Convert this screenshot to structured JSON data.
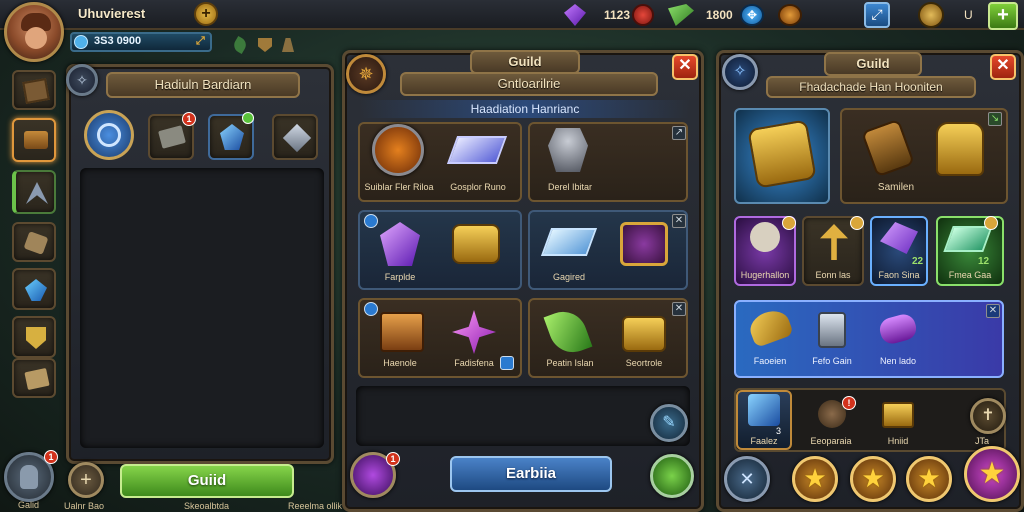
{
  "topbar": {
    "player_name": "Uhuvierest",
    "gold_value": "3S3 0900",
    "purple_value": "1123",
    "green_value": "1800",
    "scroll_value": "U"
  },
  "left_panel": {
    "banner": "Hadiuln Bardiarn",
    "guild_button": "Guiid",
    "bottom_labels": [
      "Ualnr Bao",
      "Skeoalbtda",
      "Reeelma ollik"
    ],
    "avatar_label": "Galid"
  },
  "center_panel": {
    "title": "Guild",
    "subtitle": "Gntloarilrie",
    "banner": "Haadiation Hanrianc",
    "items": [
      "Suiblar Fler Riloa",
      "Gosplor Runo",
      "Derel Ibitar",
      "Farplde",
      "",
      "Gagired",
      "",
      "Haenole",
      "Fadisfena",
      "Peatin Islan",
      "Seortrole"
    ],
    "button": "Earbiia"
  },
  "right_panel": {
    "title": "Guild",
    "banner": "Fhadachade Han Hooniten",
    "featured_label": "Samilen",
    "row2": [
      "Hugerhallon",
      "Eonn las",
      "Faon Sina",
      "Fmea Gaa"
    ],
    "row2_counts": [
      "",
      "",
      "22",
      "12"
    ],
    "row3": [
      "Faoeien",
      "Fefo Gain",
      "Nen lado"
    ],
    "row4": [
      "Faalez",
      "Eeoparaia",
      "Hniid",
      "JTa"
    ]
  },
  "colors": {
    "accent_gold": "#d9a63a",
    "accent_green": "#55b03a",
    "accent_blue": "#3a8ed9",
    "close_red": "#d23a1c"
  }
}
